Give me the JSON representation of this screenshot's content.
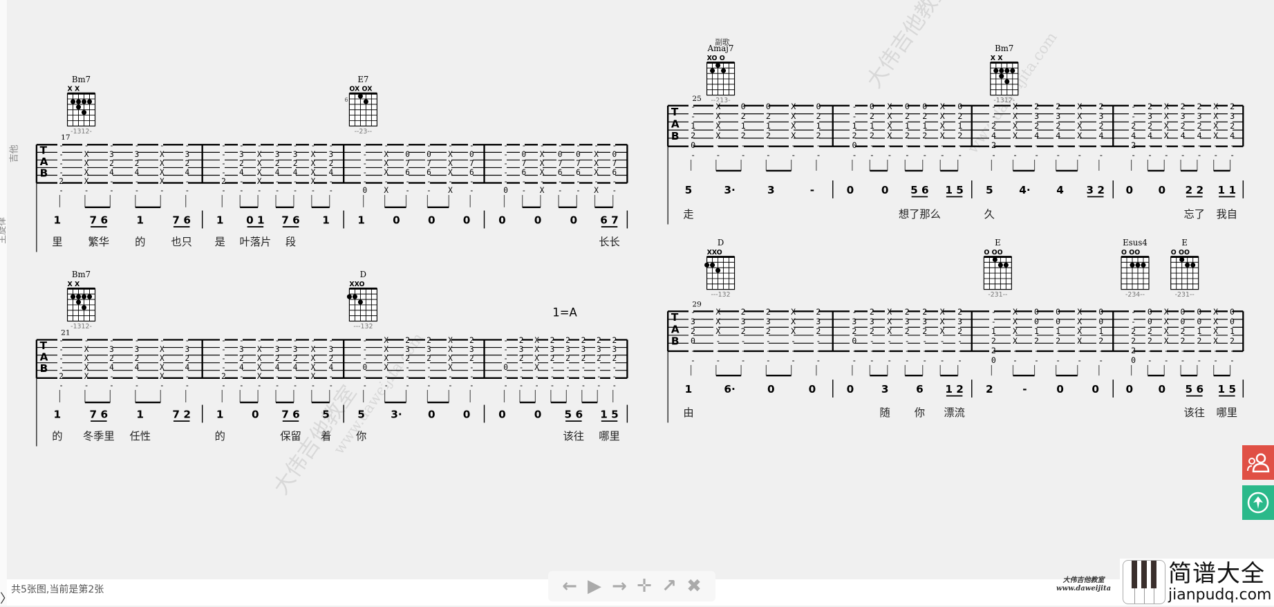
{
  "viewer": {
    "footer_text": "共5张图,当前是第2张",
    "toolbar": [
      {
        "name": "prev-icon",
        "glyph": "🡄"
      },
      {
        "name": "play-icon",
        "glyph": "▶"
      },
      {
        "name": "next-icon",
        "glyph": "➡"
      },
      {
        "name": "move-icon",
        "glyph": "✥"
      },
      {
        "name": "open-external-icon",
        "glyph": "⧉"
      },
      {
        "name": "close-icon",
        "glyph": "✖"
      }
    ],
    "side_buttons": {
      "contact_color": "#e05045",
      "top_color": "#2bb98a"
    },
    "logo": {
      "cn": "简谱大全",
      "url": "jianpudq.com"
    },
    "watermark_bottom": {
      "cn": "大伟吉他教室",
      "url": "www.daweijita"
    },
    "watermark": {
      "cn": "大伟吉他教室",
      "url": "www.daweijita.com"
    }
  },
  "score": {
    "track_labels": {
      "guitar": "吉他",
      "melody": "主旋律"
    },
    "key_marker": "1=A",
    "section_label": "副歌",
    "systems": [
      {
        "measure_number": "17",
        "chords": [
          {
            "name": "Bm7",
            "top": "X    X",
            "fingers": "-1312-",
            "dots": [
              [
                2,
                2
              ],
              [
                3,
                2
              ],
              [
                4,
                2
              ],
              [
                5,
                2
              ],
              [
                3,
                3
              ],
              [
                4,
                4
              ]
            ]
          },
          {
            "name": "E7",
            "top": "OX OX",
            "fingers": "--23--",
            "dots": [
              [
                3,
                1
              ],
              [
                4,
                2
              ]
            ],
            "fret": "6"
          }
        ],
        "measures": [
          {
            "tab": [
              "----2-",
              "-XXXX-",
              "-324--",
              "-324--",
              "-XXXX-",
              "-324--"
            ],
            "jianpu": [
              "1",
              "7 6",
              "1",
              "7 6"
            ],
            "lyrics": [
              "里",
              "繁华",
              "的",
              "也只"
            ]
          },
          {
            "tab": [
              "----2-",
              "-324--",
              "-XXXX-",
              "-324--",
              "-324--",
              "-XXXX-",
              "-324--"
            ],
            "jianpu": [
              "1",
              "0 1",
              "7 6",
              "1"
            ],
            "lyrics": [
              "是",
              "叶落片",
              "段"
            ]
          },
          {
            "tab": [
              "-----0",
              "-XXX-X",
              "-076--",
              "-076--",
              "-XXX-X",
              "-076--"
            ],
            "jianpu": [
              "1",
              "0",
              "0",
              "0"
            ],
            "lyrics": []
          },
          {
            "tab": [
              "-----0",
              "-076--",
              "-XXX-X",
              "-076--",
              "-076--",
              "-XXX-X",
              "-076--"
            ],
            "jianpu": [
              "0",
              "0",
              "0",
              "6 7"
            ],
            "lyrics": [
              "",
              "",
              "",
              "长长"
            ]
          }
        ]
      },
      {
        "measure_number": "21",
        "chords": [
          {
            "name": "Bm7",
            "top": "X    X",
            "fingers": "-1312-",
            "dots": [
              [
                2,
                2
              ],
              [
                3,
                2
              ],
              [
                4,
                2
              ],
              [
                5,
                2
              ],
              [
                3,
                3
              ],
              [
                4,
                4
              ]
            ]
          },
          {
            "name": "D",
            "top": "XXO",
            "fingers": "---132",
            "dots": [
              [
                2,
                2
              ],
              [
                1,
                2
              ],
              [
                3,
                3
              ]
            ]
          }
        ],
        "measures": [
          {
            "tab": [
              "----2-",
              "-XXXX-",
              "-324--",
              "-324--",
              "-XXXX-",
              "-324--"
            ],
            "jianpu": [
              "1",
              "7 6",
              "1",
              "7 2"
            ],
            "lyrics": [
              "的",
              "冬季里",
              "任性",
              ""
            ]
          },
          {
            "tab": [
              "----2-",
              "-324--",
              "-XXXX-",
              "-324--",
              "-324--",
              "-XXXX-",
              "-324--"
            ],
            "jianpu": [
              "1",
              "0",
              "7 6",
              "5"
            ],
            "lyrics": [
              "的",
              "",
              "保留",
              "着"
            ]
          },
          {
            "tab": [
              "---0--",
              "XXXX--",
              "232---",
              "232---",
              "XXXX--",
              "232---"
            ],
            "jianpu": [
              "5",
              "3·",
              "0",
              "0"
            ],
            "lyrics": [
              "你"
            ]
          },
          {
            "tab": [
              "---0--",
              "232---",
              "XXXX--",
              "232---",
              "232---",
              "232---",
              "232---",
              "232---"
            ],
            "jianpu": [
              "0",
              "0",
              "5 6",
              "1 5"
            ],
            "lyrics": [
              "",
              "",
              "该往",
              "哪里"
            ]
          }
        ]
      },
      {
        "measure_number": "25",
        "chords": [
          {
            "name": "Amaj7",
            "top": "XO   O",
            "fingers": "--213-",
            "dots": [
              [
                3,
                1
              ],
              [
                4,
                2
              ],
              [
                2,
                2
              ]
            ]
          },
          {
            "name": "Bm7",
            "top": "X    X",
            "fingers": "-1312-",
            "dots": [
              [
                2,
                2
              ],
              [
                3,
                2
              ],
              [
                4,
                2
              ],
              [
                5,
                2
              ],
              [
                3,
                3
              ],
              [
                4,
                4
              ]
            ]
          }
        ],
        "measures": [
          {
            "tab": [
              "--120-",
              "XXXX--",
              "0212--",
              "0212--",
              "XXXX--",
              "0212--"
            ],
            "jianpu": [
              "5",
              "3·",
              "3",
              "-"
            ],
            "lyrics": [
              "走"
            ]
          },
          {
            "tab": [
              "--120-",
              "0212--",
              "XXXX--",
              "0212--",
              "0212--",
              "XXXX--",
              "0212--"
            ],
            "jianpu": [
              "0",
              "0",
              "5 6",
              "1 5"
            ],
            "lyrics": [
              "",
              "",
              "想了那么",
              ""
            ]
          },
          {
            "tab": [
              "--242-",
              "XXXX--",
              "2324--",
              "2324--",
              "XXXX--",
              "2324--"
            ],
            "jianpu": [
              "5",
              "4·",
              "4",
              "3 2"
            ],
            "lyrics": [
              "久"
            ]
          },
          {
            "tab": [
              "--242-",
              "2324--",
              "XXXX--",
              "2324--",
              "2324--",
              "XXXX--",
              "2324--"
            ],
            "jianpu": [
              "0",
              "0",
              "2 2",
              "1 1"
            ],
            "lyrics": [
              "",
              "",
              "忘了",
              "我自"
            ]
          }
        ]
      },
      {
        "measure_number": "29",
        "chords": [
          {
            "name": "D",
            "top": "XXO",
            "fingers": "---132",
            "dots": [
              [
                2,
                2
              ],
              [
                1,
                2
              ],
              [
                3,
                3
              ]
            ]
          },
          {
            "name": "E",
            "top": "O   OO",
            "fingers": "-231--",
            "dots": [
              [
                3,
                1
              ],
              [
                4,
                2
              ],
              [
                5,
                2
              ]
            ]
          },
          {
            "name": "Esus4",
            "top": "O   OO",
            "fingers": "-234--",
            "dots": [
              [
                3,
                2
              ],
              [
                4,
                2
              ],
              [
                5,
                2
              ]
            ]
          },
          {
            "name": "E",
            "top": "O   OO",
            "fingers": "-231--",
            "dots": [
              [
                3,
                1
              ],
              [
                4,
                2
              ],
              [
                5,
                2
              ]
            ]
          }
        ],
        "measures": [
          {
            "tab": [
              "-320--",
              "XXX---",
              "232---",
              "232---",
              "XXX---",
              "232---"
            ],
            "jianpu": [
              "1",
              "6·",
              "0",
              "0"
            ],
            "lyrics": [
              "由"
            ]
          },
          {
            "tab": [
              "-320--",
              "232---",
              "XXX---",
              "232---",
              "232---",
              "XXX---",
              "232---"
            ],
            "jianpu": [
              "0",
              "3",
              "6",
              "1 2"
            ],
            "lyrics": [
              "",
              "随",
              "你",
              "漂流"
            ]
          },
          {
            "tab": [
              "--1220",
              "XXXX--",
              "0012--",
              "0012--",
              "XXXX--",
              "0012--"
            ],
            "jianpu": [
              "2",
              "-",
              "0",
              "0"
            ],
            "lyrics": []
          },
          {
            "tab": [
              "--2220",
              "0022--",
              "XXXX--",
              "0022--",
              "0012--",
              "XXXX--",
              "0012--"
            ],
            "jianpu": [
              "0",
              "0",
              "5 6",
              "1 5"
            ],
            "lyrics": [
              "",
              "",
              "该往",
              "哪里"
            ]
          }
        ]
      }
    ]
  }
}
